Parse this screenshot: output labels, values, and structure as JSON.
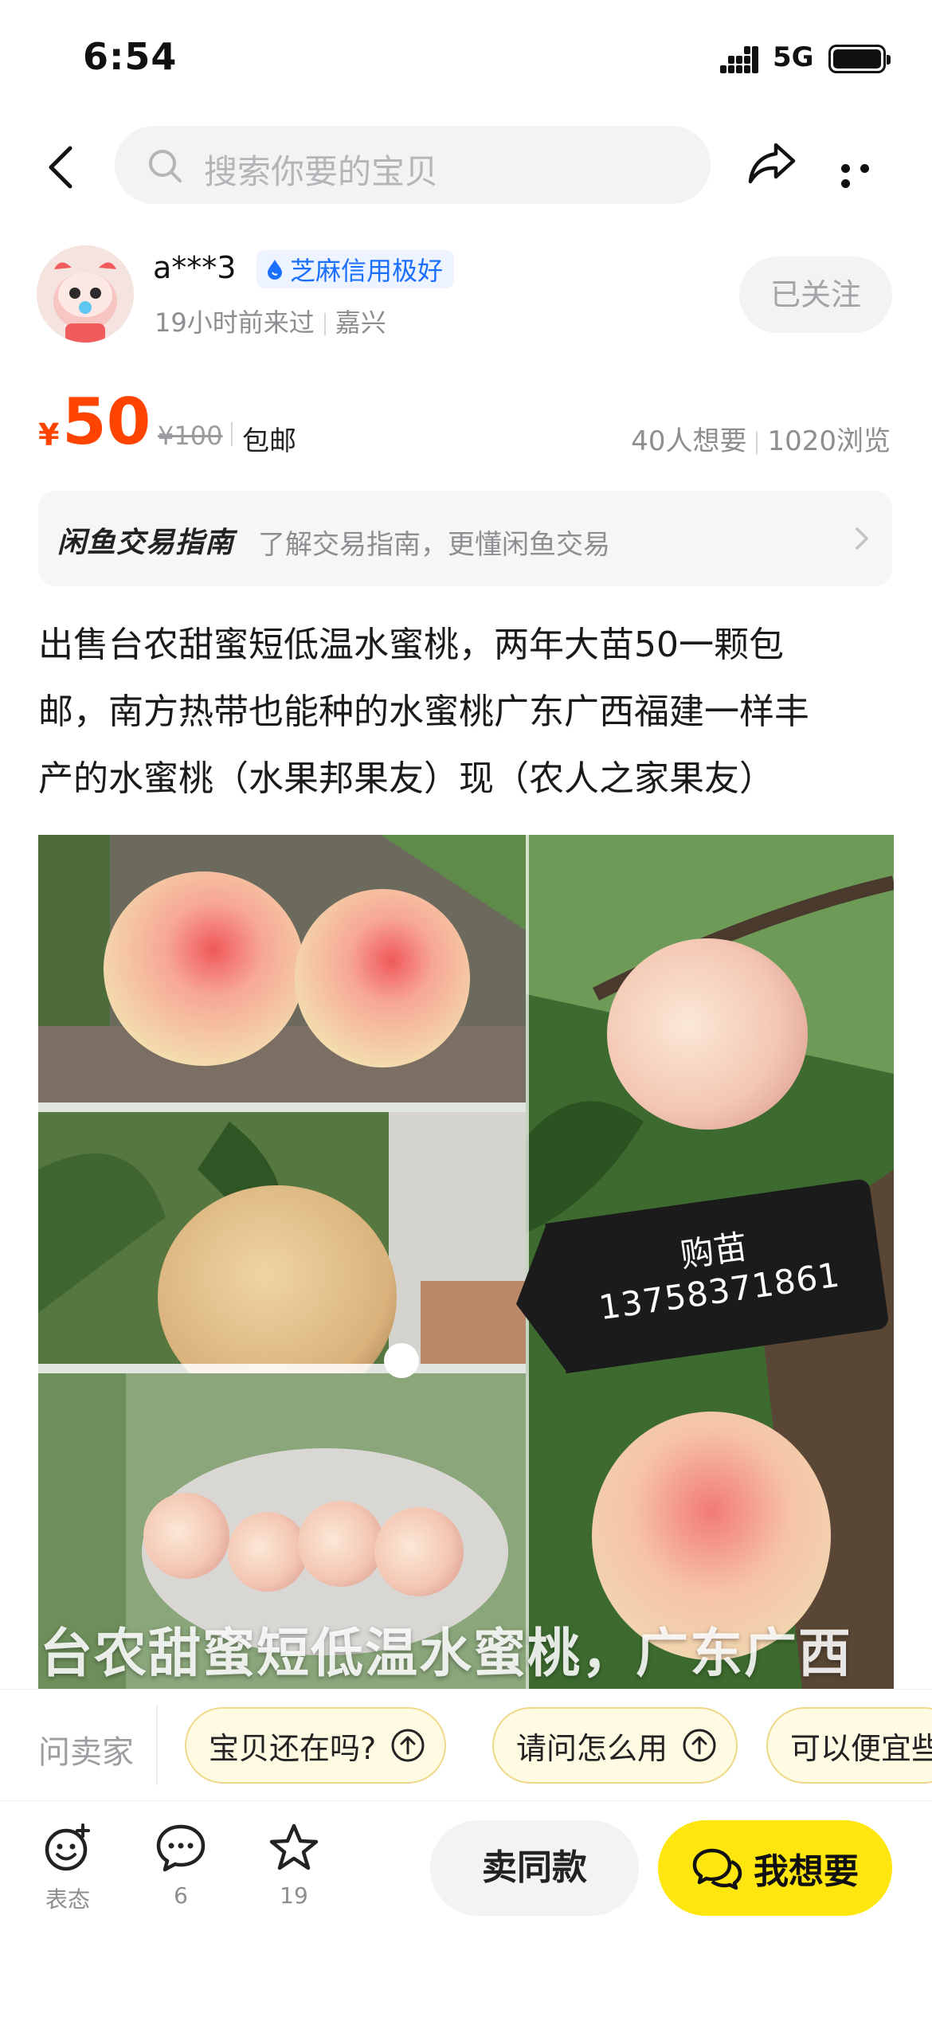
{
  "status_bar": {
    "time": "6:54",
    "network": "5G"
  },
  "nav": {
    "search_placeholder": "搜索你要的宝贝"
  },
  "seller": {
    "name": "a***3",
    "credit_badge": "芝麻信用极好",
    "last_seen": "19小时前来过",
    "location": "嘉兴",
    "follow_label": "已关注"
  },
  "price": {
    "currency": "¥",
    "current": "50",
    "original": "¥100",
    "shipping": "包邮",
    "wants": "40人想要",
    "views": "1020浏览"
  },
  "guide": {
    "title": "闲鱼交易指南",
    "desc": "了解交易指南，更懂闲鱼交易"
  },
  "description": [
    "出售台农甜蜜短低温水蜜桃，两年大苗50一颗包",
    "邮，南方热带也能种的水蜜桃广东广西福建一样丰",
    "产的水蜜桃（水果邦果友）现（农人之家果友）"
  ],
  "photo": {
    "tag_line1": "购苗",
    "tag_line2": "13758371861",
    "watermark": "台农甜蜜短低温水蜜桃，广东广西"
  },
  "quick_questions": {
    "ask_label": "问卖家",
    "chips": [
      "宝贝还在吗?",
      "请问怎么用",
      "可以便宜些"
    ]
  },
  "bottom_bar": {
    "react_label": "表态",
    "comment_count": "6",
    "favorite_count": "19",
    "sell_same_label": "卖同款",
    "want_label": "我想要"
  },
  "colors": {
    "price": "#ff4400",
    "want_button": "#ffe60f",
    "credit": "#1a6fff"
  }
}
